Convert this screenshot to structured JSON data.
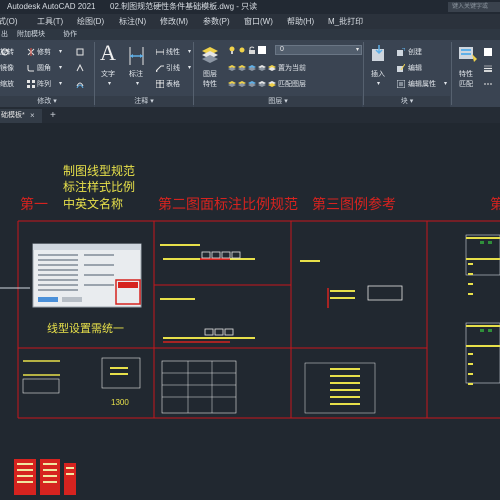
{
  "titlebar": {
    "app_name": "Autodesk AutoCAD 2021",
    "doc_name": "02.制图规范硬性条件基础模板.dwg - 只读",
    "search_placeholder": "键入关键字或"
  },
  "menubar": {
    "items": [
      "式(O)",
      "工具(T)",
      "绘图(D)",
      "标注(N)",
      "修改(M)",
      "参数(P)",
      "窗口(W)",
      "帮助(H)",
      "M_批打印"
    ]
  },
  "ribbon_tabs": [
    "出",
    "附加模块",
    "协作"
  ],
  "ribbon": {
    "modify": {
      "move": "旋转",
      "trim": "修剪",
      "mirror": "镜像",
      "fillet": "圆角",
      "scale": "缩放",
      "array": "阵列",
      "footer": "修改"
    },
    "annotation": {
      "text": "文字",
      "dimension": "标注",
      "linear": "线性",
      "leader": "引线",
      "table": "表格",
      "footer": "注释"
    },
    "layers": {
      "properties_line1": "图层",
      "properties_line2": "特性",
      "current_layer": "0",
      "set_current": "置为当前",
      "match_layer": "匹配图层",
      "footer": "图层"
    },
    "block": {
      "insert": "插入",
      "create": "创建",
      "edit": "编辑",
      "edit_attributes": "编辑属性",
      "footer": "块"
    },
    "properties": {
      "line1": "特性",
      "line2": "匹配"
    }
  },
  "doc_tab": {
    "label": "础模板*",
    "close": "×",
    "new_tab": "+"
  },
  "drawing": {
    "headers": {
      "section1_title": "第一",
      "section1_note1": "制图线型规范",
      "section1_note2": "标注样式比例",
      "section1_note3": "中英文名称",
      "section2_title": "第二图面标注比例规范",
      "section3_title": "第三图例参考",
      "section4_title": "第"
    },
    "section1_caption": "线型设置需统一",
    "dim_value": "1300",
    "colors": {
      "background": "#212830",
      "frame": "#c8161b",
      "yellow": "#e7e04a",
      "accent_red": "#d6231f"
    }
  }
}
